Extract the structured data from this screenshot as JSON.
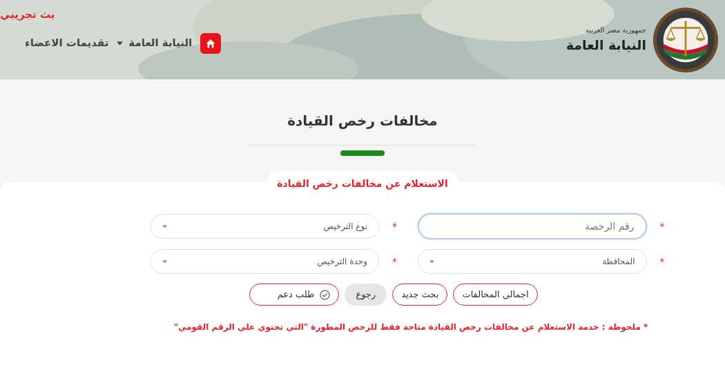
{
  "header": {
    "brand": {
      "subtitle": "جمهورية مصر العربية",
      "title": "النيابة العامة"
    },
    "nav": [
      {
        "kind": "home"
      },
      {
        "kind": "dropdown",
        "label": "النيابة العامة"
      },
      {
        "kind": "link",
        "label": "تقديمات الاعضاء"
      }
    ],
    "banner": "بث تجريبي"
  },
  "page_title": "مخالفات رخص القيادة",
  "form": {
    "title": "الاستعلام عن مخالفات رخص القيادة",
    "fields": [
      {
        "kind": "input",
        "placeholder": "رقم الرخصة",
        "required_mark": "*",
        "focused": true
      },
      {
        "kind": "select",
        "placeholder": "نوع الترخيص",
        "required_mark": "*",
        "focused": false
      },
      {
        "kind": "select",
        "placeholder": "المحافظة",
        "required_mark": "*",
        "focused": false
      },
      {
        "kind": "select",
        "placeholder": "وحدة الترخيص",
        "required_mark": "*",
        "focused": false
      }
    ],
    "buttons": [
      {
        "kind": "outline",
        "label": "اجمالي المخالفات"
      },
      {
        "kind": "outline",
        "label": "بحث جديد"
      },
      {
        "kind": "gray",
        "label": "رجوع"
      },
      {
        "kind": "support",
        "label": "طلب دعم"
      }
    ],
    "note": "* ملحوظة : خدمة الاستعلام عن مخالفات رخص القيادة متاحة فقط للرخص المطورة \"التي تحتوي علي الرقم القومي\""
  }
}
